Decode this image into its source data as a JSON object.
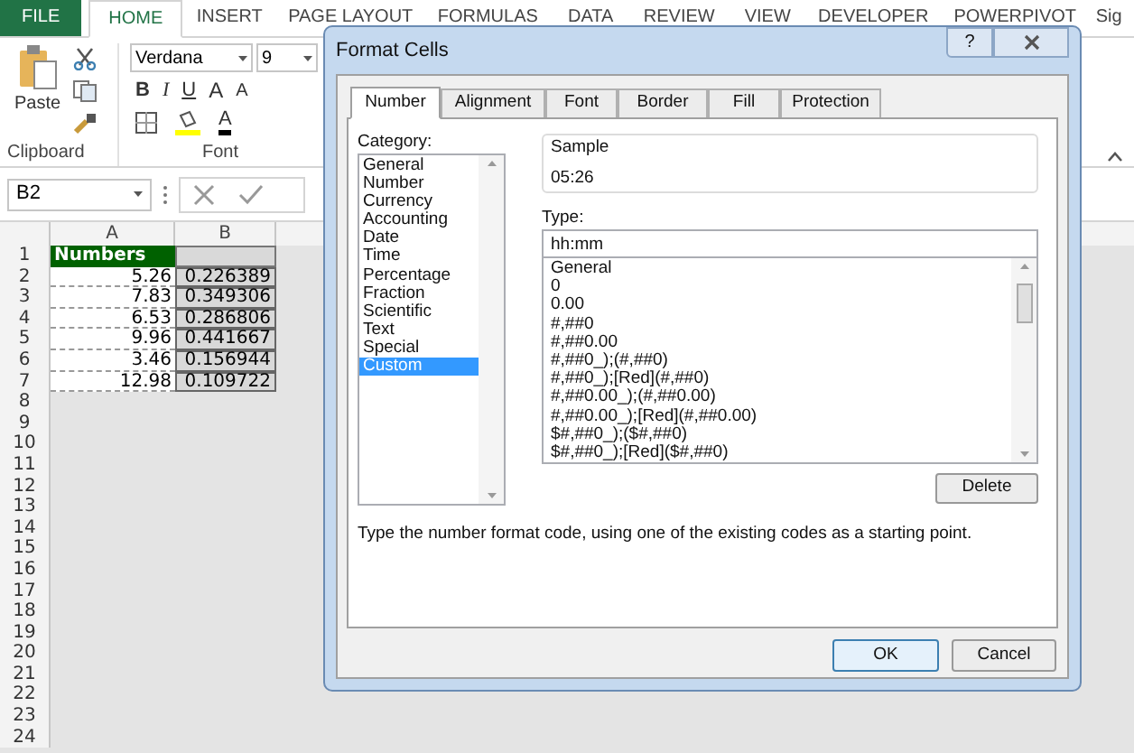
{
  "ribbon_tabs": [
    {
      "label": "FILE",
      "kind": "file",
      "selected": false
    },
    {
      "label": "HOME",
      "kind": "tab",
      "selected": true
    },
    {
      "label": "INSERT",
      "kind": "tab",
      "selected": false
    },
    {
      "label": "PAGE LAYOUT",
      "kind": "tab",
      "selected": false
    },
    {
      "label": "FORMULAS",
      "kind": "tab",
      "selected": false
    },
    {
      "label": "DATA",
      "kind": "tab",
      "selected": false
    },
    {
      "label": "REVIEW",
      "kind": "tab",
      "selected": false
    },
    {
      "label": "VIEW",
      "kind": "tab",
      "selected": false
    },
    {
      "label": "DEVELOPER",
      "kind": "tab",
      "selected": false
    },
    {
      "label": "POWERPIVOT",
      "kind": "tab",
      "selected": false
    },
    {
      "label": "Sig",
      "kind": "tab",
      "selected": false
    }
  ],
  "clipboard": {
    "paste_label": "Paste",
    "group_label": "Clipboard"
  },
  "font_group": {
    "font_name": "Verdana",
    "font_size": "9",
    "bold": "B",
    "italic": "I",
    "underline": "U",
    "grow": "A",
    "shrink": "A",
    "font_color": "A",
    "group_label": "Font"
  },
  "formula_bar": {
    "name_box": "B2"
  },
  "sheet": {
    "columns": [
      "A",
      "B"
    ],
    "rows": [
      {
        "number": "1",
        "kind": "header",
        "a": "Numbers"
      },
      {
        "number": "2",
        "kind": "data",
        "a": "5.26",
        "b": "0.226389"
      },
      {
        "number": "3",
        "kind": "data",
        "a": "7.83",
        "b": "0.349306"
      },
      {
        "number": "4",
        "kind": "data",
        "a": "6.53",
        "b": "0.286806"
      },
      {
        "number": "5",
        "kind": "data",
        "a": "9.96",
        "b": "0.441667"
      },
      {
        "number": "6",
        "kind": "data",
        "a": "3.46",
        "b": "0.156944"
      },
      {
        "number": "7",
        "kind": "data",
        "a": "12.98",
        "b": "0.109722"
      }
    ],
    "empty_rows": [
      "8",
      "9",
      "10",
      "11",
      "12",
      "13",
      "14",
      "15",
      "16",
      "17",
      "18",
      "19",
      "20",
      "21",
      "22",
      "23",
      "24"
    ]
  },
  "dialog": {
    "title": "Format Cells",
    "help": "?",
    "tabs": [
      {
        "label": "Number",
        "selected": true
      },
      {
        "label": "Alignment",
        "selected": false
      },
      {
        "label": "Font",
        "selected": false
      },
      {
        "label": "Border",
        "selected": false
      },
      {
        "label": "Fill",
        "selected": false
      },
      {
        "label": "Protection",
        "selected": false
      }
    ],
    "category_label": "Category:",
    "categories": [
      {
        "label": "General",
        "selected": false
      },
      {
        "label": "Number",
        "selected": false
      },
      {
        "label": "Currency",
        "selected": false
      },
      {
        "label": "Accounting",
        "selected": false
      },
      {
        "label": "Date",
        "selected": false
      },
      {
        "label": "Time",
        "selected": false
      },
      {
        "label": "Percentage",
        "selected": false
      },
      {
        "label": "Fraction",
        "selected": false
      },
      {
        "label": "Scientific",
        "selected": false
      },
      {
        "label": "Text",
        "selected": false
      },
      {
        "label": "Special",
        "selected": false
      },
      {
        "label": "Custom",
        "selected": true
      }
    ],
    "sample_label": "Sample",
    "sample_value": "05:26",
    "type_label": "Type:",
    "type_value": "hh:mm",
    "formats": [
      "General",
      "0",
      "0.00",
      "#,##0",
      "#,##0.00",
      "#,##0_);(#,##0)",
      "#,##0_);[Red](#,##0)",
      "#,##0.00_);(#,##0.00)",
      "#,##0.00_);[Red](#,##0.00)",
      "$#,##0_);($#,##0)",
      "$#,##0_);[Red]($#,##0)"
    ],
    "delete_button": "Delete",
    "description": "Type the number format code, using one of the existing codes as a starting point.",
    "ok_button": "OK",
    "cancel_button": "Cancel"
  }
}
